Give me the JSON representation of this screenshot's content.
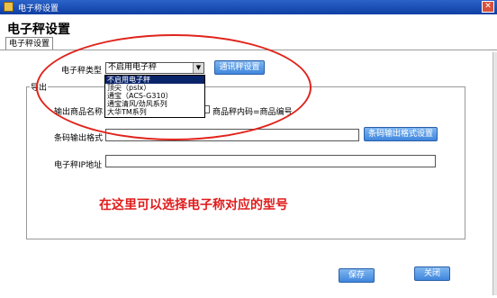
{
  "window": {
    "title": "电子称设置",
    "close_glyph": "✕"
  },
  "page": {
    "heading": "电子秤设置"
  },
  "tabs": [
    {
      "label": "电子秤设置",
      "active": true
    }
  ],
  "scale_type": {
    "label": "电子秤类型",
    "value": "不启用电子秤",
    "arrow": "▼",
    "options": [
      "不启用电子秤",
      "顶尖（pslx）",
      "通宝（ACS-G310）",
      "通宝清风/劲风系列",
      "大华TM系列"
    ],
    "selected_index": 0
  },
  "buttons": {
    "sync": "通讯秤设置",
    "barcode_format": "条码输出格式设置",
    "save": "保存",
    "close": "关闭"
  },
  "export_group": {
    "legend": "导出",
    "product_name_label": "输出商品名称",
    "plu_label": "商品秤内码=商品编号",
    "barcode_format_label": "条码输出格式",
    "barcode_format_value": "",
    "ip_label": "电子秤IP地址",
    "ip_value": ""
  },
  "annotation": "在这里可以选择电子称对应的型号",
  "colors": {
    "annotation": "#e01b1b",
    "button": "#3f86dd",
    "titlebar": "#1f52b8"
  }
}
